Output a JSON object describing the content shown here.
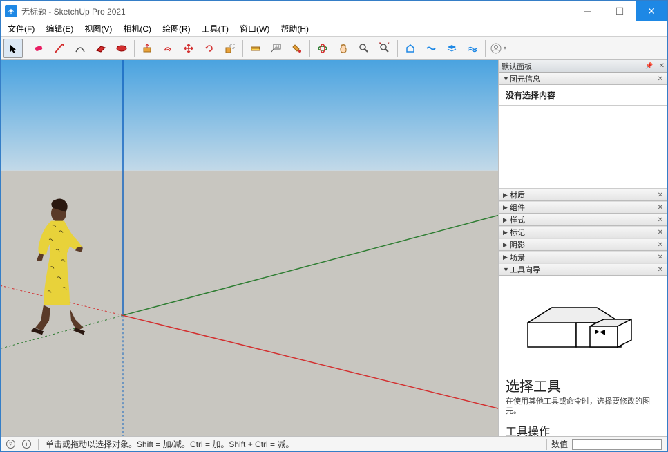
{
  "app": {
    "title": "无标题 - SketchUp Pro 2021",
    "logo_char": "◈"
  },
  "menus": {
    "file": "文件(F)",
    "edit": "编辑(E)",
    "view": "视图(V)",
    "camera": "相机(C)",
    "draw": "绘图(R)",
    "tools": "工具(T)",
    "window": "窗口(W)",
    "help": "帮助(H)"
  },
  "tray": {
    "title": "默认面板",
    "entity_info": {
      "title": "图元信息",
      "body": "没有选择内容"
    },
    "panels": {
      "materials": "材质",
      "components": "组件",
      "styles": "样式",
      "tags": "标记",
      "shadows": "阴影",
      "scenes": "场景",
      "instructor": "工具向导"
    },
    "instructor": {
      "tool_title": "选择工具",
      "tool_desc": "在使用其他工具或命令时，选择要修改的图元。",
      "ops_title": "工具操作"
    }
  },
  "status": {
    "hint": "单击或拖动以选择对象。Shift = 加/减。Ctrl = 加。Shift + Ctrl = 减。",
    "measure_label": "数值"
  },
  "colors": {
    "red_axis": "#d32f2f",
    "green_axis": "#2e7d32",
    "blue_axis": "#1565c0",
    "sky_top": "#4aa3e0",
    "sky_bottom": "#c2d9e8",
    "ground": "#c8c6c0"
  }
}
